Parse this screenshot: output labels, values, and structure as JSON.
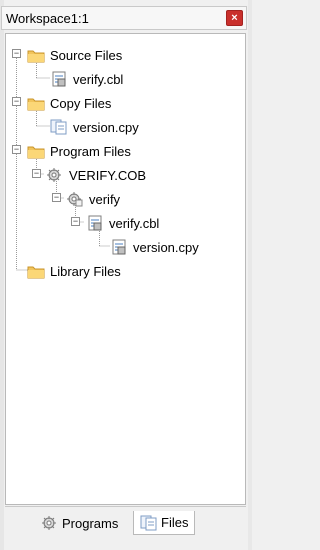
{
  "window": {
    "title": "Workspace1:1",
    "close_label": "×"
  },
  "tree": {
    "source_files": {
      "label": "Source Files",
      "expander": "−"
    },
    "source_verify_cbl": {
      "label": "verify.cbl"
    },
    "copy_files": {
      "label": "Copy Files",
      "expander": "−"
    },
    "copy_version_cpy": {
      "label": "version.cpy"
    },
    "program_files": {
      "label": "Program Files",
      "expander": "−"
    },
    "verify_cob": {
      "label": "VERIFY.COB",
      "expander": "−"
    },
    "verify_program": {
      "label": "verify",
      "expander": "−"
    },
    "verify_cbl_child": {
      "label": "verify.cbl",
      "expander": "−"
    },
    "version_cpy_child": {
      "label": "version.cpy"
    },
    "library_files": {
      "label": "Library Files"
    }
  },
  "tabs": [
    {
      "label": "Programs",
      "active": false
    },
    {
      "label": "Files",
      "active": true
    }
  ]
}
